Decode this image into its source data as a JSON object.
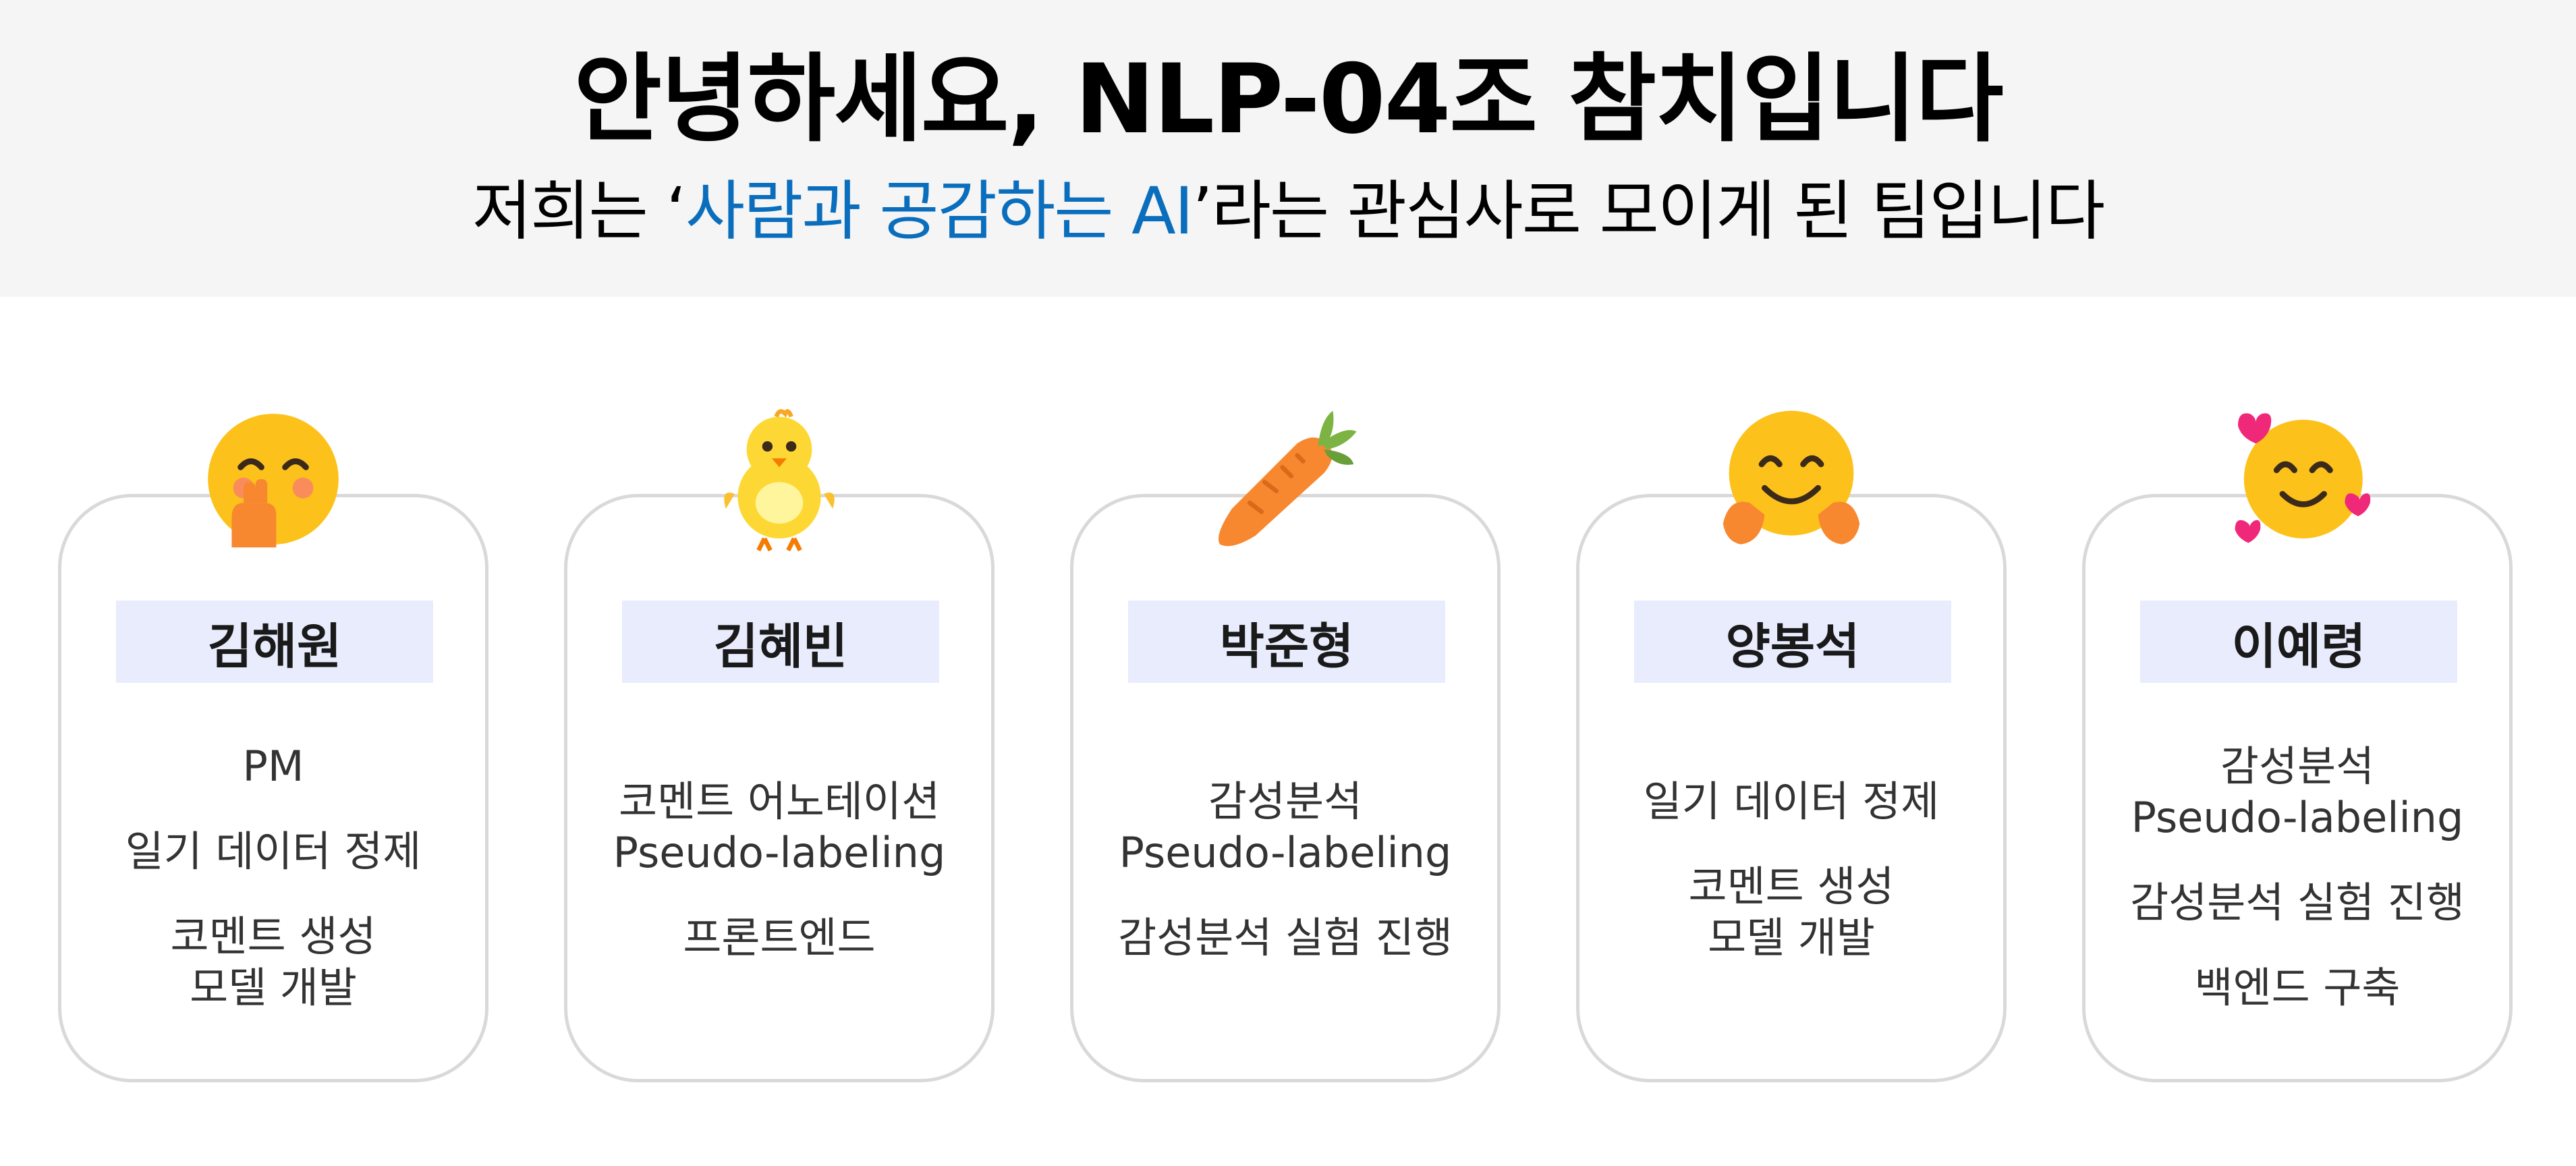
{
  "header": {
    "title": "안녕하세요, NLP-04조 참치입니다",
    "subtitle_pre": "저희는 ‘",
    "subtitle_highlight": "사람과 공감하는 AI",
    "subtitle_post": "’라는 관심사로 모이게 된 팀입니다",
    "highlight_color": "#0a6ebd"
  },
  "members": [
    {
      "name": "김해원",
      "emoji": "hand-over-mouth-face-icon",
      "roles": [
        [
          "PM"
        ],
        [
          "일기 데이터 정제"
        ],
        [
          "코멘트 생성",
          "모델 개발"
        ]
      ]
    },
    {
      "name": "김혜빈",
      "emoji": "chick-icon",
      "roles": [
        [
          "코멘트 어노테이션",
          "Pseudo-labeling"
        ],
        [
          "프론트엔드"
        ]
      ]
    },
    {
      "name": "박준형",
      "emoji": "carrot-icon",
      "roles": [
        [
          "감성분석",
          "Pseudo-labeling"
        ],
        [
          "감성분석 실험 진행"
        ]
      ]
    },
    {
      "name": "양봉석",
      "emoji": "hugging-face-icon",
      "roles": [
        [
          "일기 데이터 정제"
        ],
        [
          "코멘트 생성",
          "모델 개발"
        ]
      ]
    },
    {
      "name": "이예령",
      "emoji": "smiling-face-with-hearts-icon",
      "roles": [
        [
          "감성분석",
          "Pseudo-labeling"
        ],
        [
          "감성분석 실험 진행"
        ],
        [
          "백엔드 구축"
        ]
      ]
    }
  ],
  "colors": {
    "name_box_bg": "#e8ecfd",
    "card_border": "#d9d9d9",
    "header_bg": "#f5f5f5"
  }
}
